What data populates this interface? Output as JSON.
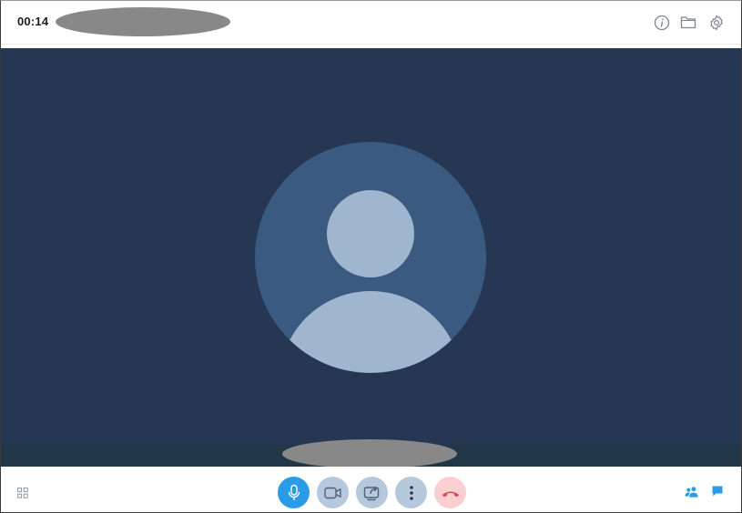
{
  "header": {
    "timer": "00:14",
    "icons": [
      "info-icon",
      "folder-icon",
      "settings-icon"
    ]
  },
  "participant": {
    "avatar_icon": "person-avatar-icon"
  },
  "controls": {
    "left_icon": "grid-layout-icon",
    "buttons": [
      "microphone-icon",
      "camera-icon",
      "screen-share-icon",
      "more-options-icon",
      "hang-up-icon"
    ],
    "right_icons": [
      "participants-icon",
      "chat-icon"
    ]
  },
  "colors": {
    "stage_background": "#263754",
    "avatar_background": "#3a5a80",
    "avatar_silhouette": "#a0b6cf",
    "accent_blue": "#2b9be8",
    "hangup_red": "#e5424a",
    "hangup_background": "#f9cfd2"
  }
}
